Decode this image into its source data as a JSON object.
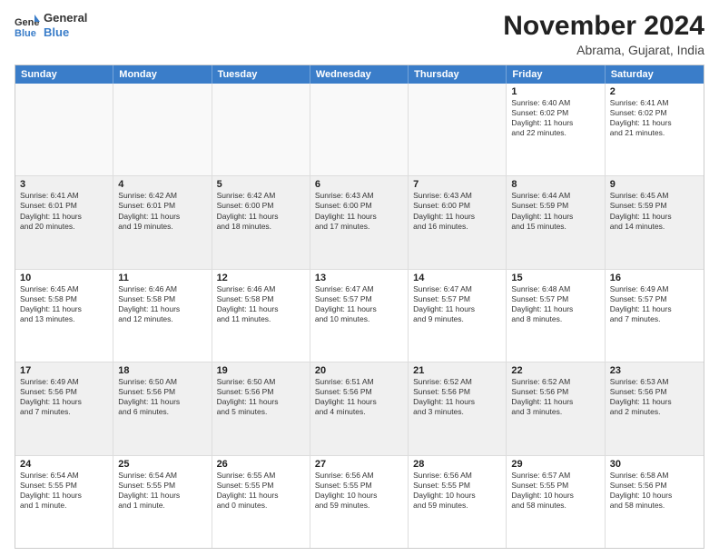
{
  "header": {
    "logo": {
      "general": "General",
      "blue": "Blue"
    },
    "title": "November 2024",
    "location": "Abrama, Gujarat, India"
  },
  "weekdays": [
    "Sunday",
    "Monday",
    "Tuesday",
    "Wednesday",
    "Thursday",
    "Friday",
    "Saturday"
  ],
  "rows": [
    [
      {
        "day": "",
        "text": "",
        "empty": true
      },
      {
        "day": "",
        "text": "",
        "empty": true
      },
      {
        "day": "",
        "text": "",
        "empty": true
      },
      {
        "day": "",
        "text": "",
        "empty": true
      },
      {
        "day": "",
        "text": "",
        "empty": true
      },
      {
        "day": "1",
        "text": "Sunrise: 6:40 AM\nSunset: 6:02 PM\nDaylight: 11 hours\nand 22 minutes.",
        "empty": false
      },
      {
        "day": "2",
        "text": "Sunrise: 6:41 AM\nSunset: 6:02 PM\nDaylight: 11 hours\nand 21 minutes.",
        "empty": false
      }
    ],
    [
      {
        "day": "3",
        "text": "Sunrise: 6:41 AM\nSunset: 6:01 PM\nDaylight: 11 hours\nand 20 minutes.",
        "empty": false
      },
      {
        "day": "4",
        "text": "Sunrise: 6:42 AM\nSunset: 6:01 PM\nDaylight: 11 hours\nand 19 minutes.",
        "empty": false
      },
      {
        "day": "5",
        "text": "Sunrise: 6:42 AM\nSunset: 6:00 PM\nDaylight: 11 hours\nand 18 minutes.",
        "empty": false
      },
      {
        "day": "6",
        "text": "Sunrise: 6:43 AM\nSunset: 6:00 PM\nDaylight: 11 hours\nand 17 minutes.",
        "empty": false
      },
      {
        "day": "7",
        "text": "Sunrise: 6:43 AM\nSunset: 6:00 PM\nDaylight: 11 hours\nand 16 minutes.",
        "empty": false
      },
      {
        "day": "8",
        "text": "Sunrise: 6:44 AM\nSunset: 5:59 PM\nDaylight: 11 hours\nand 15 minutes.",
        "empty": false
      },
      {
        "day": "9",
        "text": "Sunrise: 6:45 AM\nSunset: 5:59 PM\nDaylight: 11 hours\nand 14 minutes.",
        "empty": false
      }
    ],
    [
      {
        "day": "10",
        "text": "Sunrise: 6:45 AM\nSunset: 5:58 PM\nDaylight: 11 hours\nand 13 minutes.",
        "empty": false
      },
      {
        "day": "11",
        "text": "Sunrise: 6:46 AM\nSunset: 5:58 PM\nDaylight: 11 hours\nand 12 minutes.",
        "empty": false
      },
      {
        "day": "12",
        "text": "Sunrise: 6:46 AM\nSunset: 5:58 PM\nDaylight: 11 hours\nand 11 minutes.",
        "empty": false
      },
      {
        "day": "13",
        "text": "Sunrise: 6:47 AM\nSunset: 5:57 PM\nDaylight: 11 hours\nand 10 minutes.",
        "empty": false
      },
      {
        "day": "14",
        "text": "Sunrise: 6:47 AM\nSunset: 5:57 PM\nDaylight: 11 hours\nand 9 minutes.",
        "empty": false
      },
      {
        "day": "15",
        "text": "Sunrise: 6:48 AM\nSunset: 5:57 PM\nDaylight: 11 hours\nand 8 minutes.",
        "empty": false
      },
      {
        "day": "16",
        "text": "Sunrise: 6:49 AM\nSunset: 5:57 PM\nDaylight: 11 hours\nand 7 minutes.",
        "empty": false
      }
    ],
    [
      {
        "day": "17",
        "text": "Sunrise: 6:49 AM\nSunset: 5:56 PM\nDaylight: 11 hours\nand 7 minutes.",
        "empty": false
      },
      {
        "day": "18",
        "text": "Sunrise: 6:50 AM\nSunset: 5:56 PM\nDaylight: 11 hours\nand 6 minutes.",
        "empty": false
      },
      {
        "day": "19",
        "text": "Sunrise: 6:50 AM\nSunset: 5:56 PM\nDaylight: 11 hours\nand 5 minutes.",
        "empty": false
      },
      {
        "day": "20",
        "text": "Sunrise: 6:51 AM\nSunset: 5:56 PM\nDaylight: 11 hours\nand 4 minutes.",
        "empty": false
      },
      {
        "day": "21",
        "text": "Sunrise: 6:52 AM\nSunset: 5:56 PM\nDaylight: 11 hours\nand 3 minutes.",
        "empty": false
      },
      {
        "day": "22",
        "text": "Sunrise: 6:52 AM\nSunset: 5:56 PM\nDaylight: 11 hours\nand 3 minutes.",
        "empty": false
      },
      {
        "day": "23",
        "text": "Sunrise: 6:53 AM\nSunset: 5:56 PM\nDaylight: 11 hours\nand 2 minutes.",
        "empty": false
      }
    ],
    [
      {
        "day": "24",
        "text": "Sunrise: 6:54 AM\nSunset: 5:55 PM\nDaylight: 11 hours\nand 1 minute.",
        "empty": false
      },
      {
        "day": "25",
        "text": "Sunrise: 6:54 AM\nSunset: 5:55 PM\nDaylight: 11 hours\nand 1 minute.",
        "empty": false
      },
      {
        "day": "26",
        "text": "Sunrise: 6:55 AM\nSunset: 5:55 PM\nDaylight: 11 hours\nand 0 minutes.",
        "empty": false
      },
      {
        "day": "27",
        "text": "Sunrise: 6:56 AM\nSunset: 5:55 PM\nDaylight: 10 hours\nand 59 minutes.",
        "empty": false
      },
      {
        "day": "28",
        "text": "Sunrise: 6:56 AM\nSunset: 5:55 PM\nDaylight: 10 hours\nand 59 minutes.",
        "empty": false
      },
      {
        "day": "29",
        "text": "Sunrise: 6:57 AM\nSunset: 5:55 PM\nDaylight: 10 hours\nand 58 minutes.",
        "empty": false
      },
      {
        "day": "30",
        "text": "Sunrise: 6:58 AM\nSunset: 5:56 PM\nDaylight: 10 hours\nand 58 minutes.",
        "empty": false
      }
    ]
  ]
}
